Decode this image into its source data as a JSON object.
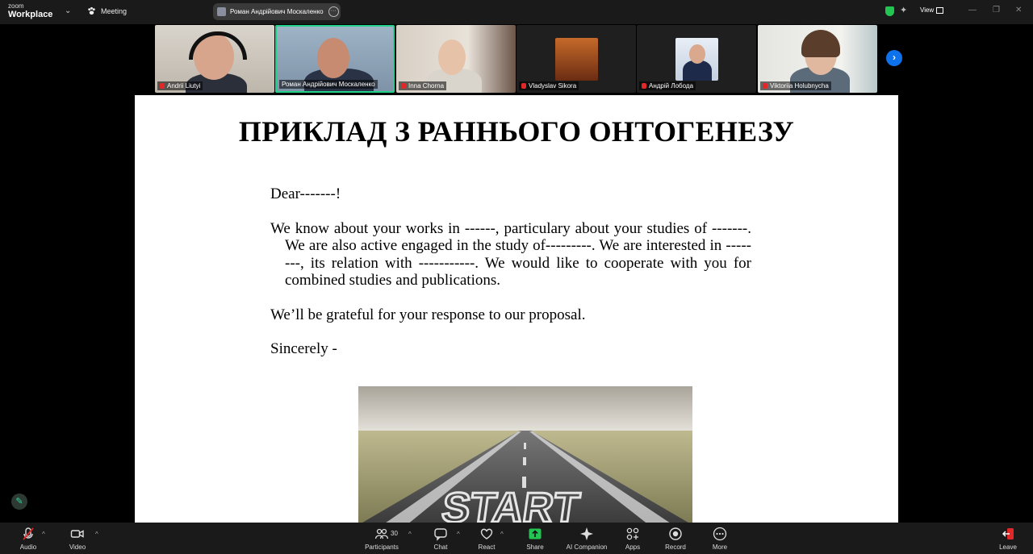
{
  "app": {
    "logo_top": "zoom",
    "logo_bottom": "Workplace",
    "meeting_label": "Meeting"
  },
  "speaker": {
    "name": "Роман Андрійович Москаленко"
  },
  "top_right": {
    "view_label": "View"
  },
  "participants": [
    {
      "name": "Andrii Liutyi",
      "muted": true,
      "active": false
    },
    {
      "name": "Роман Андрійович Москаленко",
      "muted": false,
      "active": true
    },
    {
      "name": "Inna Chorna",
      "muted": true,
      "active": false
    },
    {
      "name": "Vladyslav Sikora",
      "muted": true,
      "active": false
    },
    {
      "name": "Андрій Лобода",
      "muted": true,
      "active": false
    },
    {
      "name": "Viktoriia Holubnycha",
      "muted": true,
      "active": false
    }
  ],
  "slide": {
    "title": "ПРИКЛАД З РАННЬОГО ОНТОГЕНЕЗУ",
    "greeting": "Dear-------!",
    "body": "We know about your works in ------, particulary about your studies of -------. We are also active engaged in the study of---------. We are interested in --------, its relation with -----------. We would like to cooperate with you for combined studies and publications.",
    "closing_1": "We’ll be grateful for your response to our proposal.",
    "closing_2": "Sincerely -",
    "image_text": "START"
  },
  "toolbar": {
    "audio": "Audio",
    "video": "Video",
    "participants": "Participants",
    "participants_count": "30",
    "chat": "Chat",
    "react": "React",
    "share": "Share",
    "ai_companion": "AI Companion",
    "apps": "Apps",
    "record": "Record",
    "more": "More",
    "leave": "Leave"
  },
  "colors": {
    "accent": "#0e72ed",
    "active_speaker": "#23d18b",
    "share_green": "#23c552",
    "muted_red": "#e02828",
    "toolbar_bg": "#1a1a1a"
  },
  "icons": [
    "shield-icon",
    "sparkle-icon",
    "microphone-off-icon",
    "video-camera-icon",
    "participants-icon",
    "chat-icon",
    "heart-icon",
    "share-screen-icon",
    "ai-sparkle-icon",
    "apps-icon",
    "record-icon",
    "more-icon",
    "leave-icon",
    "chevron-right-icon",
    "pencil-icon"
  ]
}
